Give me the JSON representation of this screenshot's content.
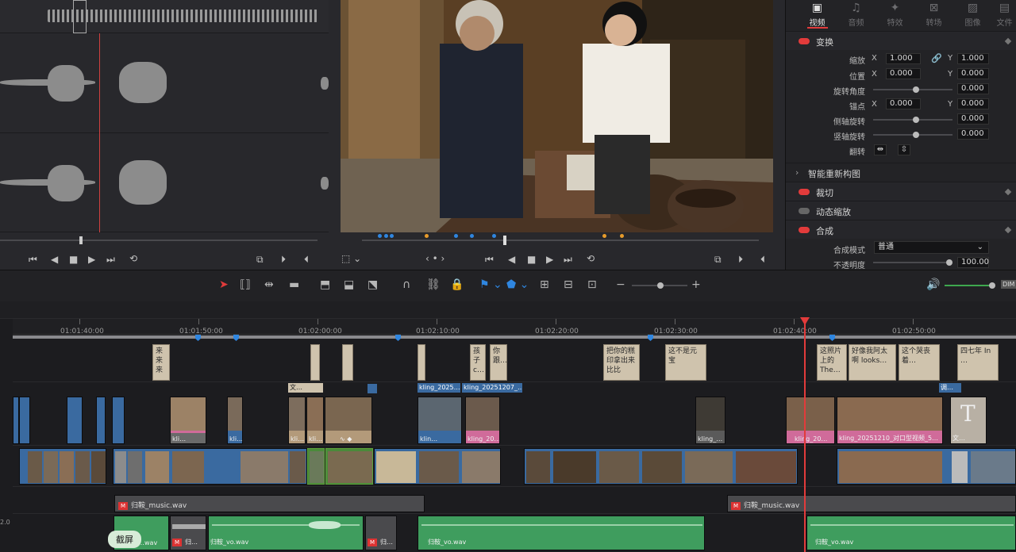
{
  "inspector": {
    "tabs": [
      {
        "label": "视频",
        "icon": "video-tab-icon",
        "active": true
      },
      {
        "label": "音频",
        "icon": "audio-tab-icon"
      },
      {
        "label": "特效",
        "icon": "effects-tab-icon"
      },
      {
        "label": "转场",
        "icon": "transition-tab-icon"
      },
      {
        "label": "图像",
        "icon": "image-tab-icon"
      },
      {
        "label": "文件",
        "icon": "file-tab-icon"
      }
    ],
    "transform": {
      "title": "变换",
      "zoom_label": "缩放",
      "zoom_x": "1.000",
      "zoom_y": "1.000",
      "position_label": "位置",
      "pos_x": "0.000",
      "pos_y": "0.000",
      "rotation_label": "旋转角度",
      "rotation": "0.000",
      "anchor_label": "锚点",
      "anchor_x": "0.000",
      "anchor_y": "0.000",
      "pitch_label": "侧轴旋转",
      "pitch": "0.000",
      "yaw_label": "竖轴旋转",
      "yaw": "0.000",
      "flip_label": "翻转",
      "x": "X",
      "y": "Y"
    },
    "smart_reframe": "智能重新构图",
    "crop": "裁切",
    "dynamic_zoom": "动态缩放",
    "composite": {
      "title": "合成",
      "mode_label": "合成模式",
      "mode_value": "普通",
      "opacity_label": "不透明度",
      "opacity_value": "100.00"
    }
  },
  "program": {
    "transport_nav": "‹ • ›"
  },
  "toolbar": {
    "audio_meter_label": "DIM"
  },
  "ruler": {
    "ticks": [
      "01:01:40:00",
      "01:01:50:00",
      "01:02:00:00",
      "01:02:10:00",
      "01:02:20:00",
      "01:02:30:00",
      "01:02:40:00",
      "01:02:50:00"
    ]
  },
  "subtitles": [
    {
      "text": "来来来"
    },
    {
      "text": ""
    },
    {
      "text": ""
    },
    {
      "text": ""
    },
    {
      "text": "孩子c…"
    },
    {
      "text": "你跟…"
    },
    {
      "text": "把你的糕印拿出来比比"
    },
    {
      "text": "这不是元宝"
    },
    {
      "text": "这照片上的 The…"
    },
    {
      "text": "好像我阿太啊 looks…"
    },
    {
      "text": "这个哭丧着…"
    },
    {
      "text": "四七年 In …"
    }
  ],
  "clips": {
    "v3_labels": [
      "文…",
      "kling_2025…",
      "kling_20251207_…",
      "调…"
    ],
    "v2_names": [
      "kli…",
      "kli…",
      "kli…",
      "kli…",
      "klin…",
      "kling_20…",
      "kling_…",
      "kling_20…",
      "kling_20251210_对口型视频_5…",
      "文…"
    ],
    "audio1": [
      "归鞍_music.wav",
      "归鞍_music.wav"
    ],
    "audio2": [
      "…wav",
      "归…",
      "归鞍_vo.wav",
      "归…",
      "归鞍_vo.wav",
      "归鞍_vo.wav"
    ]
  },
  "track_label": "2.0",
  "tooltip": "截屏",
  "colors": {
    "accent_red": "#e23b3b",
    "clip_blue": "#3a6aa0",
    "clip_pink": "#d06b9a",
    "audio_green": "#3f9d5e",
    "subtitle": "#cfc3ad"
  }
}
